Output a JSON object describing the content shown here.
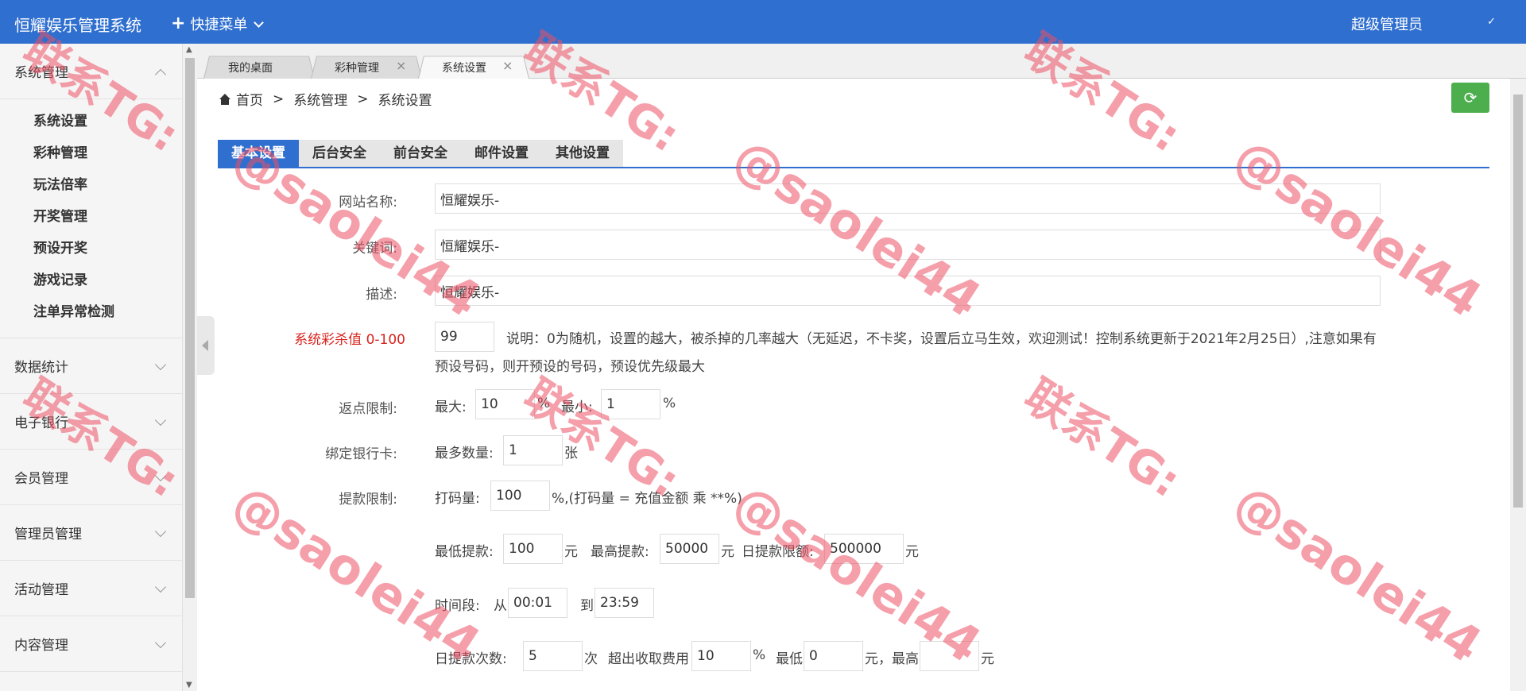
{
  "app": {
    "title": "恒耀娱乐管理系统",
    "quick_menu": "快捷菜单",
    "user": "超级管理员",
    "user_check": "✓"
  },
  "sidebar": {
    "groups": [
      {
        "label": "系统管理",
        "open": true
      },
      {
        "label": "数据统计"
      },
      {
        "label": "电子银行"
      },
      {
        "label": "会员管理"
      },
      {
        "label": "管理员管理"
      },
      {
        "label": "活动管理"
      },
      {
        "label": "内容管理"
      }
    ],
    "subitems": [
      "系统设置",
      "彩种管理",
      "玩法倍率",
      "开奖管理",
      "预设开奖",
      "游戏记录",
      "注单异常检测"
    ]
  },
  "page_tabs": [
    {
      "label": "我的桌面"
    },
    {
      "label": "彩种管理",
      "close": "×"
    },
    {
      "label": "系统设置",
      "close": "×",
      "active": true
    }
  ],
  "breadcrumb": {
    "home": "首页",
    "sep": ">",
    "level1": "系统管理",
    "level2": "系统设置"
  },
  "refresh_icon": "⟳",
  "settings_tabs": [
    "基本设置",
    "后台安全",
    "前台安全",
    "邮件设置",
    "其他设置"
  ],
  "form": {
    "site_name": {
      "label": "网站名称:",
      "value": "恒耀娱乐-"
    },
    "keywords": {
      "label": "关键词:",
      "value": "恒耀娱乐-"
    },
    "description": {
      "label": "描述:",
      "value": "恒耀娱乐-"
    },
    "kill_rate": {
      "label": "系统彩杀值 0-100",
      "value": "99",
      "note": "说明：0为随机，设置的越大，被杀掉的几率越大（无延迟，不卡奖，设置后立马生效，欢迎测试！控制系统更新于2021年2月25日）,注意如果有预设号码，则开预设的号码，预设优先级最大"
    },
    "rebate": {
      "label": "返点限制:",
      "max_label": "最大:",
      "max_value": "10",
      "pct": "%",
      "min_label": "最小:",
      "min_value": "1"
    },
    "bank_card": {
      "label": "绑定银行卡:",
      "max_label": "最多数量:",
      "value": "1",
      "unit": "张"
    },
    "withdraw": {
      "label": "提款限制:",
      "bet_label": "打码量:",
      "bet_value": "100",
      "bet_note": "%,(打码量 = 充值金额 乘 **%)",
      "min_label": "最低提款:",
      "min_value": "100",
      "yuan": "元",
      "max_label": "最高提款:",
      "max_value": "50000",
      "daily_label": "日提款限额:",
      "daily_value": "500000",
      "time_label": "时间段:",
      "from_label": "从",
      "from_value": "00:01",
      "to_label": "到",
      "to_value": "23:59",
      "count_label": "日提款次数:",
      "count_value": "5",
      "count_unit": "次",
      "fee_label": "超出收取费用",
      "fee_value": "10",
      "low_label": "最低",
      "low_value": "0",
      "high_label": "元，最高",
      "high_value": ""
    }
  },
  "watermark": {
    "line1": "联系TG:",
    "line2": "@saolei44"
  }
}
